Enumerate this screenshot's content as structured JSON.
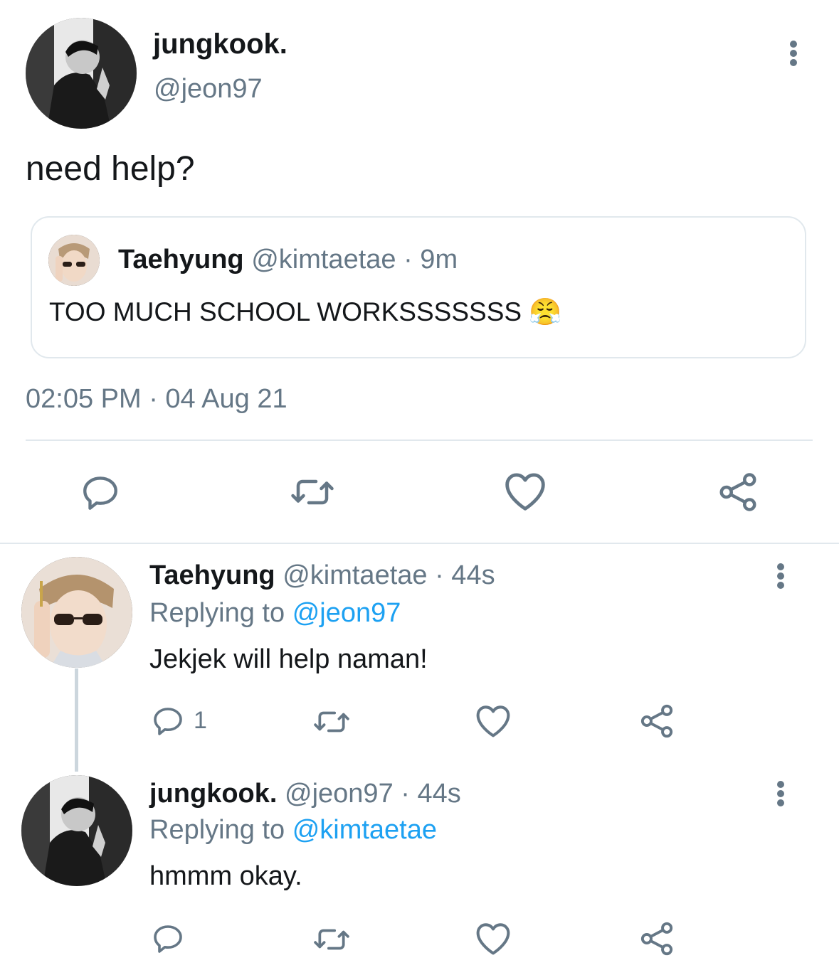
{
  "main_tweet": {
    "display_name": "jungkook.",
    "handle": "@jeon97",
    "text": "need help?",
    "timestamp": "02:05 PM · 04 Aug 21"
  },
  "quoted_tweet": {
    "display_name": "Taehyung",
    "handle": "@kimtaetae",
    "age": "· 9m",
    "text": "TOO MUCH SCHOOL WORKSSSSSSS",
    "emoji": "😤"
  },
  "replies": [
    {
      "display_name": "Taehyung",
      "handle": "@kimtaetae",
      "age": "· 44s",
      "replying_prefix": "Replying to",
      "replying_to": "@jeon97",
      "text": "Jekjek will help naman!",
      "reply_count": "1"
    },
    {
      "display_name": "jungkook.",
      "handle": "@jeon97",
      "age": "· 44s",
      "replying_prefix": "Replying to",
      "replying_to": "@kimtaetae",
      "text": "hmmm okay.",
      "reply_count": ""
    }
  ],
  "icons": {
    "reply": "reply-icon",
    "retweet": "retweet-icon",
    "like": "heart-icon",
    "share": "share-icon",
    "more": "more-options-icon"
  },
  "colors": {
    "text": "#14171a",
    "muted": "#657786",
    "link": "#1da1f2",
    "divider": "#e1e8ed"
  }
}
